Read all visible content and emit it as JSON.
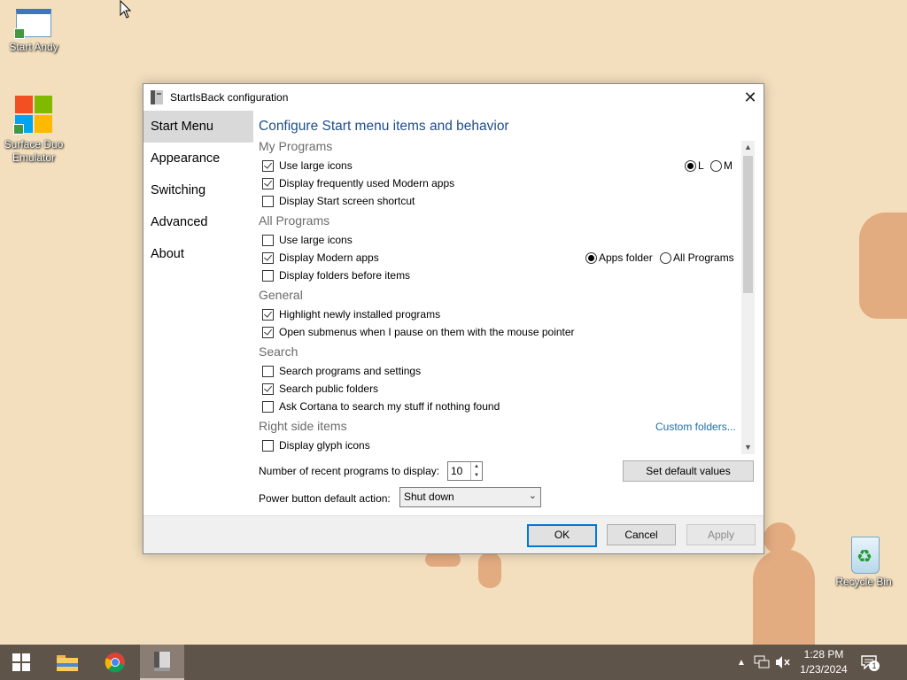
{
  "desktop": {
    "icons": [
      {
        "label": "Start Andy"
      },
      {
        "label": "Surface Duo Emulator"
      },
      {
        "label": "Recycle Bin"
      }
    ]
  },
  "window": {
    "title": "StartIsBack configuration",
    "close_glyph": "✕",
    "nav": [
      "Start Menu",
      "Appearance",
      "Switching",
      "Advanced",
      "About"
    ],
    "selected_nav": "Start Menu",
    "heading": "Configure Start menu items and behavior",
    "groups": {
      "my_programs": "My Programs",
      "all_programs": "All Programs",
      "general": "General",
      "search": "Search",
      "right_side": "Right side items"
    },
    "options": {
      "mp_large_icons": {
        "label": "Use large icons",
        "checked": true
      },
      "mp_frequent_modern": {
        "label": "Display frequently used Modern apps",
        "checked": true
      },
      "mp_start_screen": {
        "label": "Display Start screen shortcut",
        "checked": false
      },
      "ap_large_icons": {
        "label": "Use large icons",
        "checked": false
      },
      "ap_modern_apps": {
        "label": "Display Modern apps",
        "checked": true
      },
      "ap_folders_before": {
        "label": "Display folders before items",
        "checked": false
      },
      "gen_highlight": {
        "label": "Highlight newly installed programs",
        "checked": true
      },
      "gen_submenus": {
        "label": "Open submenus when I pause on them with the mouse pointer",
        "checked": true
      },
      "s_programs_settings": {
        "label": "Search programs and settings",
        "checked": false
      },
      "s_public_folders": {
        "label": "Search public folders",
        "checked": true
      },
      "s_cortana": {
        "label": "Ask Cortana to search my stuff if nothing found",
        "checked": false
      },
      "r_glyph_icons": {
        "label": "Display glyph icons",
        "checked": false
      }
    },
    "radios": {
      "size_l": {
        "label": "L",
        "selected": true
      },
      "size_m": {
        "label": "M",
        "selected": false
      },
      "apps_folder": {
        "label": "Apps folder",
        "selected": true
      },
      "all_programs": {
        "label": "All Programs",
        "selected": false
      }
    },
    "custom_folders_link": "Custom folders...",
    "recent_label": "Number of recent programs to display:",
    "recent_value": "10",
    "set_default": "Set default values",
    "power_label": "Power button default action:",
    "power_value": "Shut down",
    "buttons": {
      "ok": "OK",
      "cancel": "Cancel",
      "apply": "Apply"
    }
  },
  "taskbar": {
    "clock_time": "1:28 PM",
    "clock_date": "1/23/2024",
    "notification_count": "1"
  },
  "colors": {
    "desktop_bg": "#f3dfbd",
    "heading_blue": "#1f4e8c",
    "link_blue": "#1f6fa8",
    "taskbar": "#5f544a",
    "default_button_border": "#0078d7"
  }
}
